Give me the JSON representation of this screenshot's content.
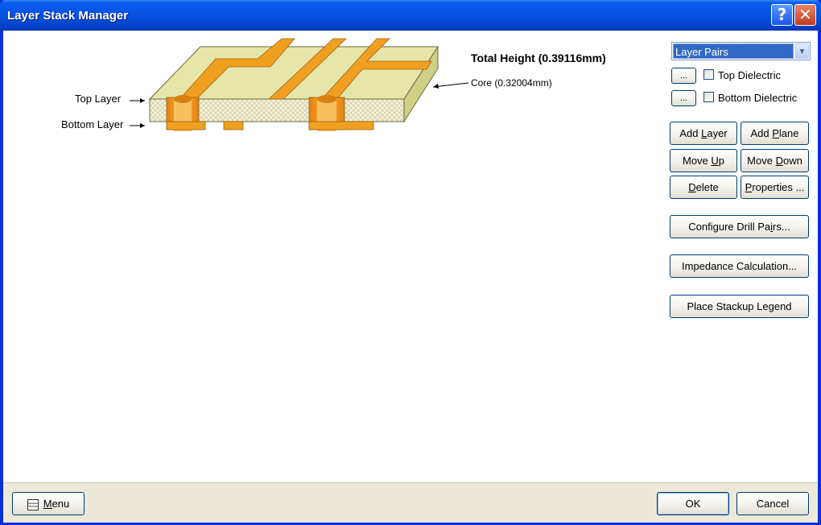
{
  "window": {
    "title": "Layer Stack Manager",
    "help_icon": "?",
    "close_icon": "✕"
  },
  "diagram": {
    "total_height": "Total Height (0.39116mm)",
    "core_label": "Core (0.32004mm)",
    "top_layer_label": "Top Layer",
    "bottom_layer_label": "Bottom Layer"
  },
  "right_panel": {
    "layer_pairs_selected": "Layer Pairs",
    "top_dielectric_button": "...",
    "top_dielectric_label": "Top Dielectric",
    "top_dielectric_checked": false,
    "bottom_dielectric_button": "...",
    "bottom_dielectric_label": "Bottom Dielectric",
    "bottom_dielectric_checked": false,
    "add_layer_pre": "Add ",
    "add_layer_acc": "L",
    "add_layer_post": "ayer",
    "add_plane_pre": "Add ",
    "add_plane_acc": "P",
    "add_plane_post": "lane",
    "move_up_pre": "Move ",
    "move_up_acc": "U",
    "move_up_post": "p",
    "move_down_pre": "Move ",
    "move_down_acc": "D",
    "move_down_post": "own",
    "delete_pre": "",
    "delete_acc": "D",
    "delete_post": "elete",
    "properties_pre": "",
    "properties_acc": "P",
    "properties_post": "roperties ...",
    "configure_drill_pre": "Configure Drill Pa",
    "configure_drill_acc": "i",
    "configure_drill_post": "rs...",
    "impedance_label": "Impedance Calculation...",
    "place_legend_label": "Place Stackup Legend"
  },
  "footer": {
    "menu_acc": "M",
    "menu_post": "enu",
    "ok_label": "OK",
    "cancel_label": "Cancel"
  },
  "colors": {
    "copper": "#f0a020",
    "dielectric_top": "#e6e6a8",
    "dielectric_side": "#d8d88e",
    "xp_blue": "#0054e3",
    "button_face": "#ece9d8"
  }
}
